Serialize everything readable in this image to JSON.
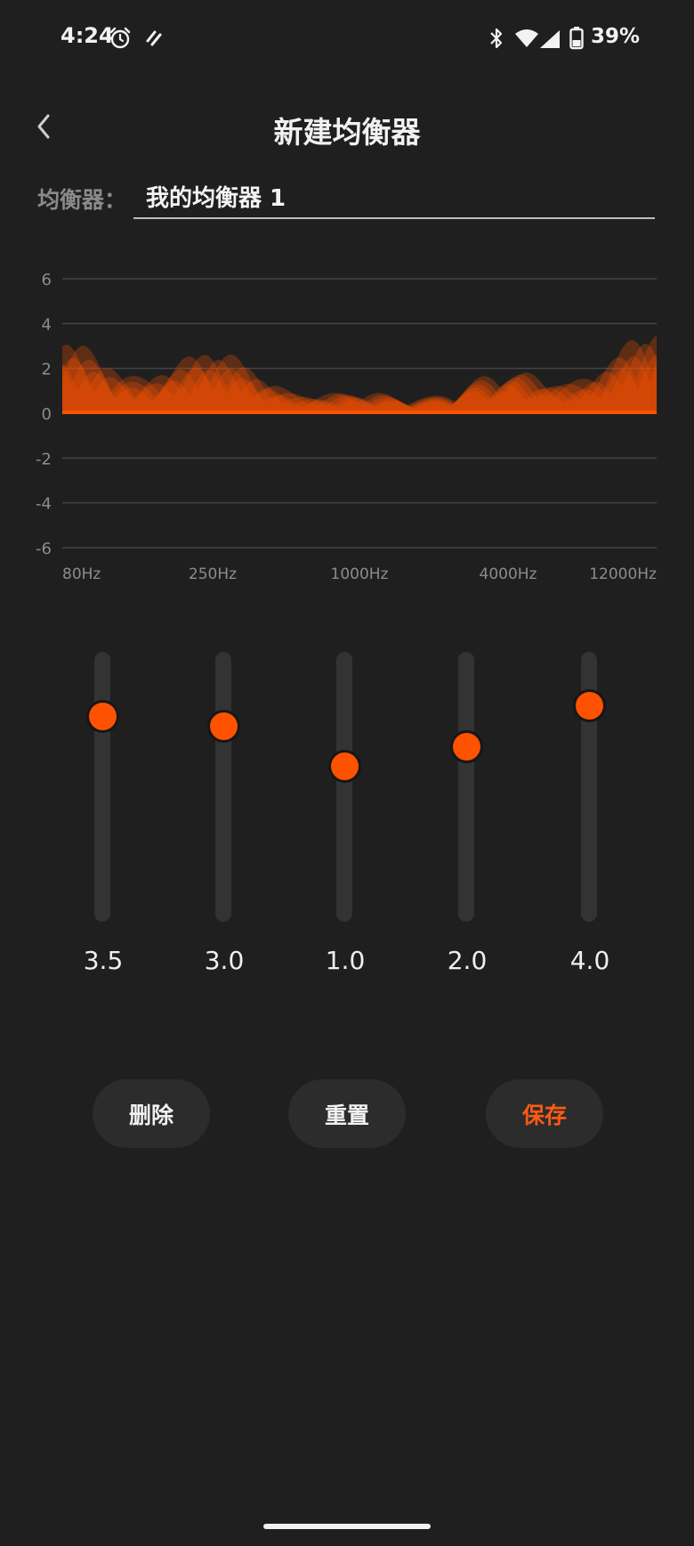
{
  "status_bar": {
    "time": "4:24",
    "battery_percent": "39%",
    "icons": [
      "alarm-icon",
      "dnd-icon",
      "bluetooth-icon",
      "wifi-icon",
      "cellular-icon",
      "battery-icon"
    ]
  },
  "header": {
    "title": "新建均衡器",
    "back_icon": "chevron-left-icon"
  },
  "name_field": {
    "label": "均衡器：",
    "value": "我的均衡器 1"
  },
  "chart_data": {
    "type": "area",
    "y_ticks": [
      "6",
      "4",
      "2",
      "0",
      "-2",
      "-4",
      "-6"
    ],
    "ylim": [
      -6,
      6
    ],
    "x_labels": [
      "80Hz",
      "250Hz",
      "1000Hz",
      "4000Hz",
      "12000Hz"
    ],
    "values": [
      3.5,
      3.0,
      1.0,
      2.0,
      4.0
    ],
    "grid": true,
    "fill_color": "#ff5200"
  },
  "bands": [
    {
      "value": 3.5,
      "label": "3.5"
    },
    {
      "value": 3.0,
      "label": "3.0"
    },
    {
      "value": 1.0,
      "label": "1.0"
    },
    {
      "value": 2.0,
      "label": "2.0"
    },
    {
      "value": 4.0,
      "label": "4.0"
    }
  ],
  "buttons": {
    "delete": "删除",
    "reset": "重置",
    "save": "保存"
  },
  "colors": {
    "accent": "#ff5200",
    "background": "#1f1f1f"
  }
}
